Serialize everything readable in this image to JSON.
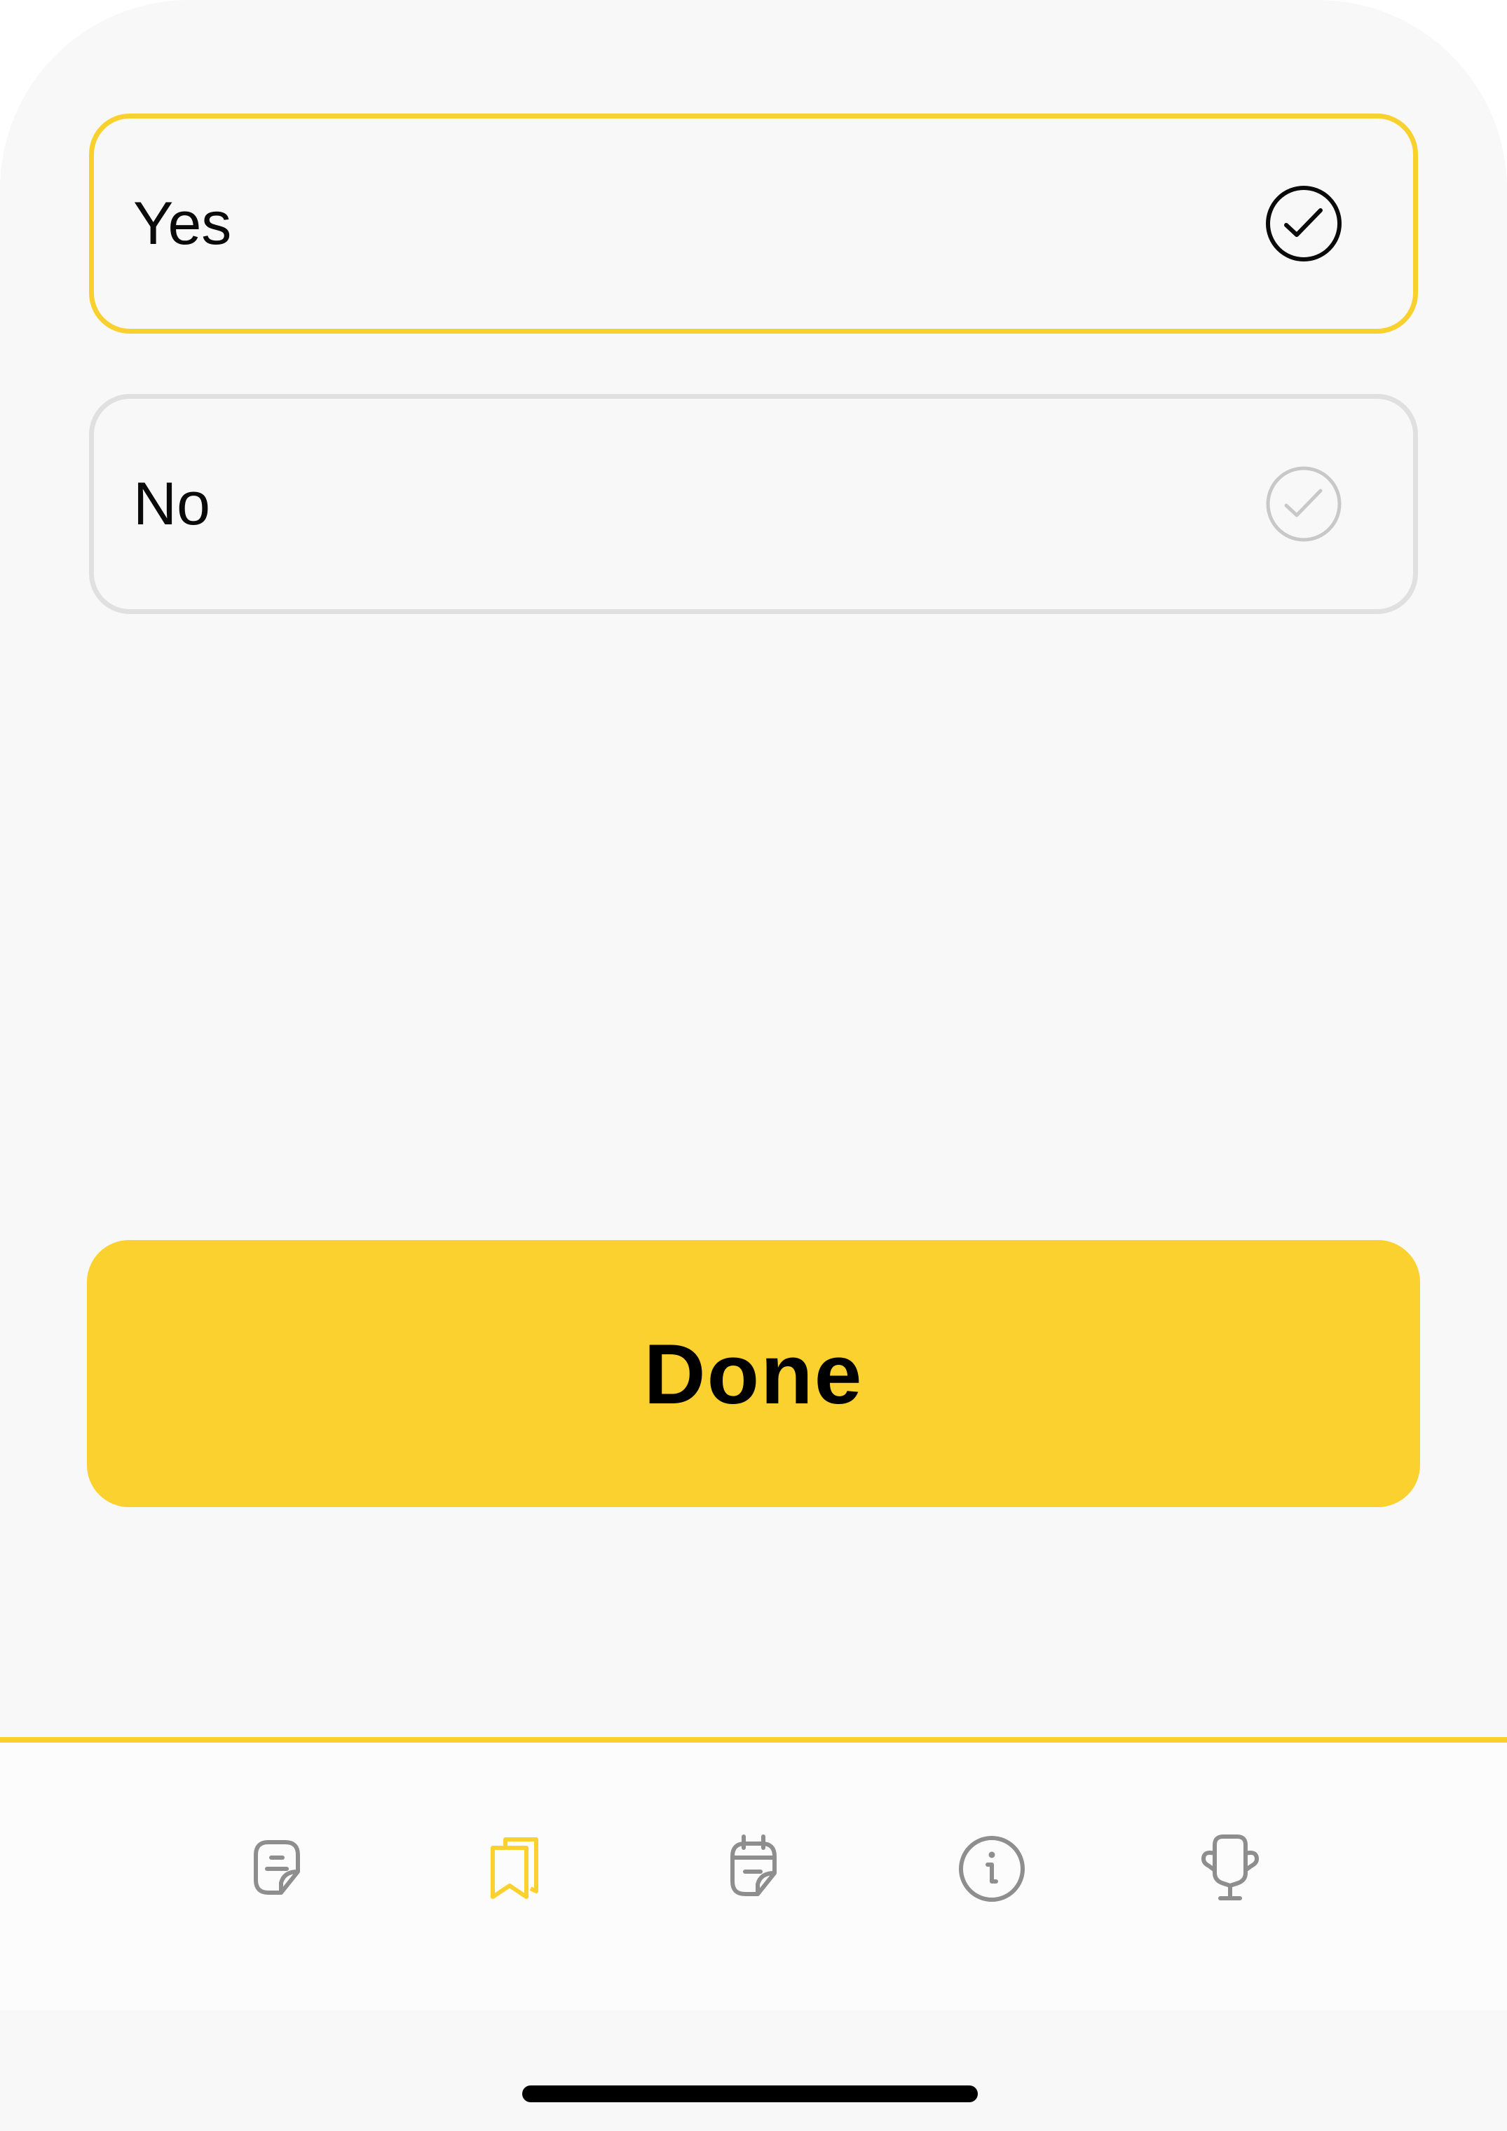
{
  "options": [
    {
      "label": "Yes",
      "selected": true
    },
    {
      "label": "No",
      "selected": false
    }
  ],
  "done_button": {
    "label": "Done"
  },
  "tabbar": {
    "items": [
      {
        "icon": "note-icon",
        "active": false
      },
      {
        "icon": "bookmarks-icon",
        "active": true
      },
      {
        "icon": "calendar-note-icon",
        "active": false
      },
      {
        "icon": "info-circle-icon",
        "active": false
      },
      {
        "icon": "trophy-icon",
        "active": false
      }
    ]
  },
  "colors": {
    "accent": "#FAD12E",
    "selected_check": "#0A0A0A",
    "unselected_check": "#C8C8C8",
    "inactive_icon": "#8E8E8E",
    "unselected_border": "#E0E0E0"
  }
}
